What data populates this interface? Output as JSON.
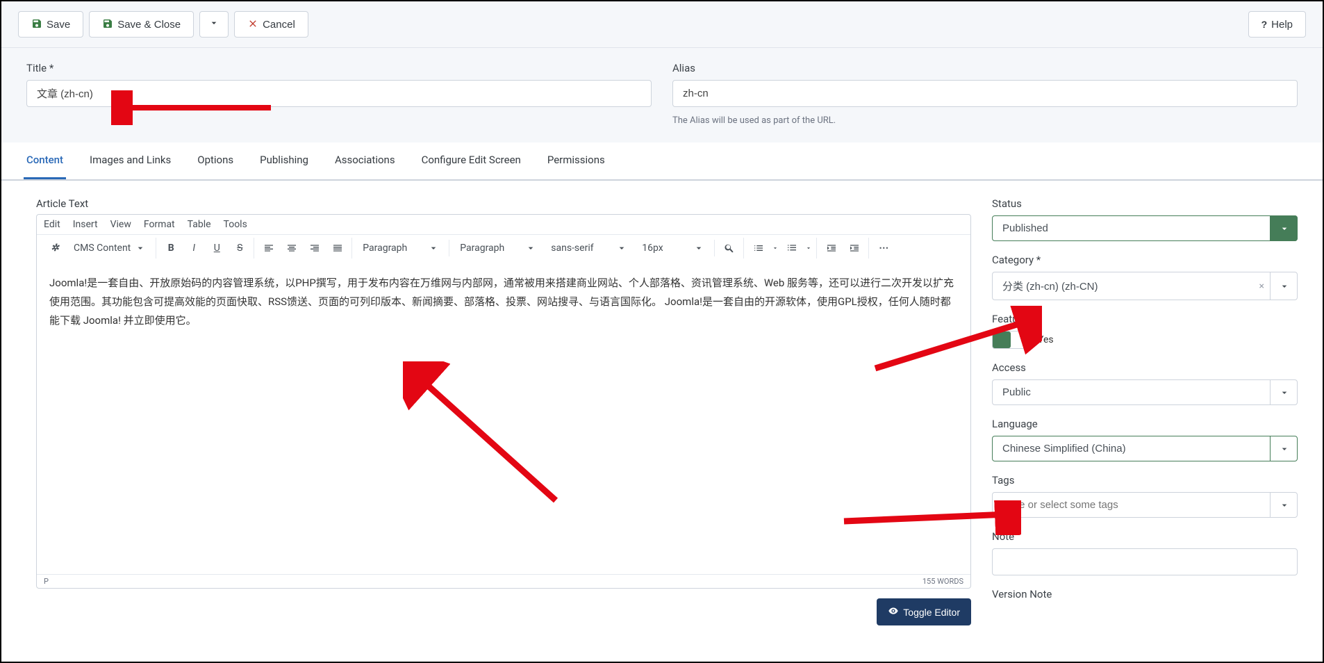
{
  "toolbar": {
    "save": "Save",
    "save_close": "Save & Close",
    "cancel": "Cancel",
    "help": "Help"
  },
  "title": {
    "label": "Title *",
    "value": "文章 (zh-cn)"
  },
  "alias": {
    "label": "Alias",
    "value": "zh-cn",
    "hint": "The Alias will be used as part of the URL."
  },
  "tabs": {
    "content": "Content",
    "images": "Images and Links",
    "options": "Options",
    "publishing": "Publishing",
    "associations": "Associations",
    "configure": "Configure Edit Screen",
    "permissions": "Permissions"
  },
  "editor": {
    "label": "Article Text",
    "menus": {
      "edit": "Edit",
      "insert": "Insert",
      "view": "View",
      "format": "Format",
      "table": "Table",
      "tools": "Tools"
    },
    "cms": "CMS Content",
    "para1": "Paragraph",
    "para2": "Paragraph",
    "font": "sans-serif",
    "size": "16px",
    "body": "Joomla!是一套自由、开放原始码的内容管理系统，以PHP撰写，用于发布内容在万维网与内部网，通常被用来搭建商业网站、个人部落格、资讯管理系统、Web 服务等，还可以进行二次开发以扩充使用范围。其功能包含可提高效能的页面快取、RSS馈送、页面的可列印版本、新闻摘要、部落格、投票、网站搜寻、与语言国际化。 Joomla!是一套自由的开源软体，使用GPL授权，任何人随时都能下载 Joomla! 并立即使用它。",
    "status_path": "P",
    "wordcount": "155 WORDS",
    "toggle": "Toggle Editor"
  },
  "sidebar": {
    "status_label": "Status",
    "status_value": "Published",
    "category_label": "Category *",
    "category_value": "分类 (zh-cn) (zh-CN)",
    "featured_label": "Featured",
    "featured_yes": "Yes",
    "access_label": "Access",
    "access_value": "Public",
    "language_label": "Language",
    "language_value": "Chinese Simplified (China)",
    "tags_label": "Tags",
    "tags_placeholder": "Type or select some tags",
    "note_label": "Note",
    "version_label": "Version Note"
  }
}
